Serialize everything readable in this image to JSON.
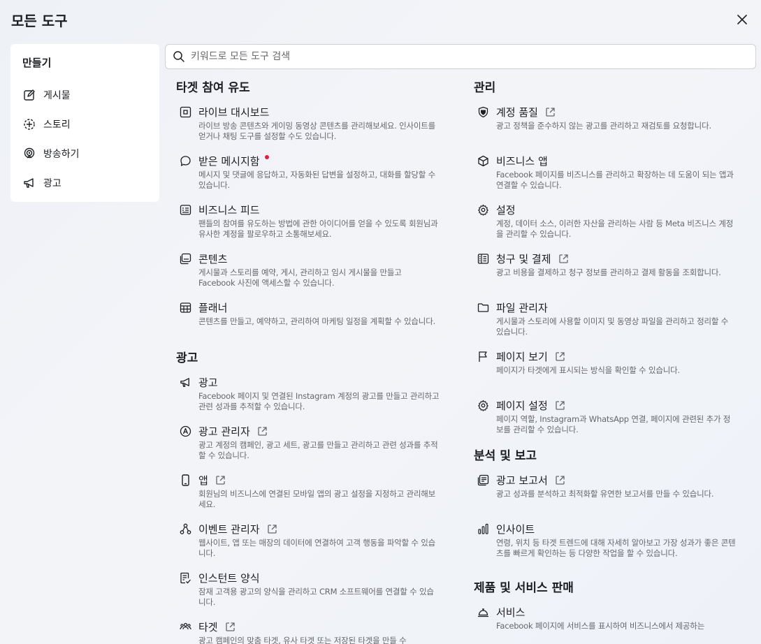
{
  "header": {
    "title": "모든 도구"
  },
  "sidebar": {
    "title": "만들기",
    "items": [
      {
        "label": "게시물",
        "icon": "edit-icon"
      },
      {
        "label": "스토리",
        "icon": "story-icon"
      },
      {
        "label": "방송하기",
        "icon": "broadcast-icon"
      },
      {
        "label": "광고",
        "icon": "megaphone-icon"
      }
    ]
  },
  "search": {
    "placeholder": "키워드로 모든 도구 검색",
    "value": ""
  },
  "sections": {
    "engage": {
      "title": "타겟 참여 유도",
      "tools": [
        {
          "name": "라이브 대시보드",
          "desc": "라이브 방송 콘텐츠와 게이밍 동영상 콘텐츠를 관리해보세요. 인사이트를 얻거나 채팅 도구를 설정할 수도 있습니다."
        },
        {
          "name": "받은 메시지함",
          "desc": "메시지 및 댓글에 응답하고, 자동화된 답변을 설정하고, 대화를 할당할 수 있습니다."
        },
        {
          "name": "비즈니스 피드",
          "desc": "팬들의 참여를 유도하는 방법에 관한 아이디어를 얻을 수 있도록 회원님과 유사한 계정을 팔로우하고 소통해보세요."
        },
        {
          "name": "콘텐츠",
          "desc": "게시물과 스토리를 예약, 게시, 관리하고 임시 게시물을 만들고 Facebook 사진에 액세스할 수 있습니다."
        },
        {
          "name": "플래너",
          "desc": "콘텐츠를 만들고, 예약하고, 관리하여 마케팅 일정을 계획할 수 있습니다."
        }
      ]
    },
    "ads": {
      "title": "광고",
      "tools": [
        {
          "name": "광고",
          "desc": "Facebook 페이지 및 연결된 Instagram 계정의 광고를 만들고 관리하고 관련 성과를 추적할 수 있습니다."
        },
        {
          "name": "광고 관리자",
          "desc": "광고 계정의 캠페인, 광고 세트, 광고를 만들고 관리하고 관련 성과를 추적할 수 있습니다."
        },
        {
          "name": "앱",
          "desc": "회원님의 비즈니스에 연결된 모바일 앱의 광고 설정을 지정하고 관리해보세요."
        },
        {
          "name": "이벤트 관리자",
          "desc": "웹사이트, 앱 또는 매장의 데이터에 연결하여 고객 행동을 파악할 수 있습니다."
        },
        {
          "name": "인스턴트 양식",
          "desc": "잠재 고객용 광고의 양식을 관리하고 CRM 소프트웨어를 연결할 수 있습니다."
        },
        {
          "name": "타겟",
          "desc": "광고 캠페인의 맞춤 타겟, 유사 타겟 또는 저장된 타겟을 만들 수"
        }
      ]
    },
    "manage": {
      "title": "관리",
      "tools": [
        {
          "name": "계정 품질",
          "desc": "광고 정책을 준수하지 않는 광고를 관리하고 재검토를 요청합니다."
        },
        {
          "name": "비즈니스 앱",
          "desc": "Facebook 페이지를 비즈니스를 관리하고 확장하는 데 도움이 되는 앱과 연결할 수 있습니다."
        },
        {
          "name": "설정",
          "desc": "계정, 데이터 소스, 이러한 자산을 관리하는 사람 등 Meta 비즈니스 계정을 관리할 수 있습니다."
        },
        {
          "name": "청구 및 결제",
          "desc": "광고 비용을 결제하고 청구 정보를 관리하고 결제 활동을 조회합니다."
        },
        {
          "name": "파일 관리자",
          "desc": "게시물과 스토리에 사용할 이미지 및 동영상 파일을 관리하고 정리할 수 있습니다."
        },
        {
          "name": "페이지 보기",
          "desc": "페이지가 타겟에게 표시되는 방식을 확인할 수 있습니다."
        },
        {
          "name": "페이지 설정",
          "desc": "페이지 역할, Instagram과 WhatsApp 연결, 페이지에 관련된 추가 정보를 관리할 수 있습니다."
        }
      ]
    },
    "analytics": {
      "title": "분석 및 보고",
      "tools": [
        {
          "name": "광고 보고서",
          "desc": "광고 성과를 분석하고 최적화할 유연한 보고서를 만들 수 있습니다."
        },
        {
          "name": "인사이트",
          "desc": "연령, 위치 등 타겟 트렌드에 대해 자세히 알아보고 가장 성과가 좋은 콘텐츠를 빠르게 확인하는 등 다양한 작업을 할 수 있습니다."
        }
      ]
    },
    "commerce": {
      "title": "제품 및 서비스 판매",
      "tools": [
        {
          "name": "서비스",
          "desc": "Facebook 페이지에 서비스를 표시하여 비즈니스에서 제공하는"
        }
      ]
    }
  }
}
